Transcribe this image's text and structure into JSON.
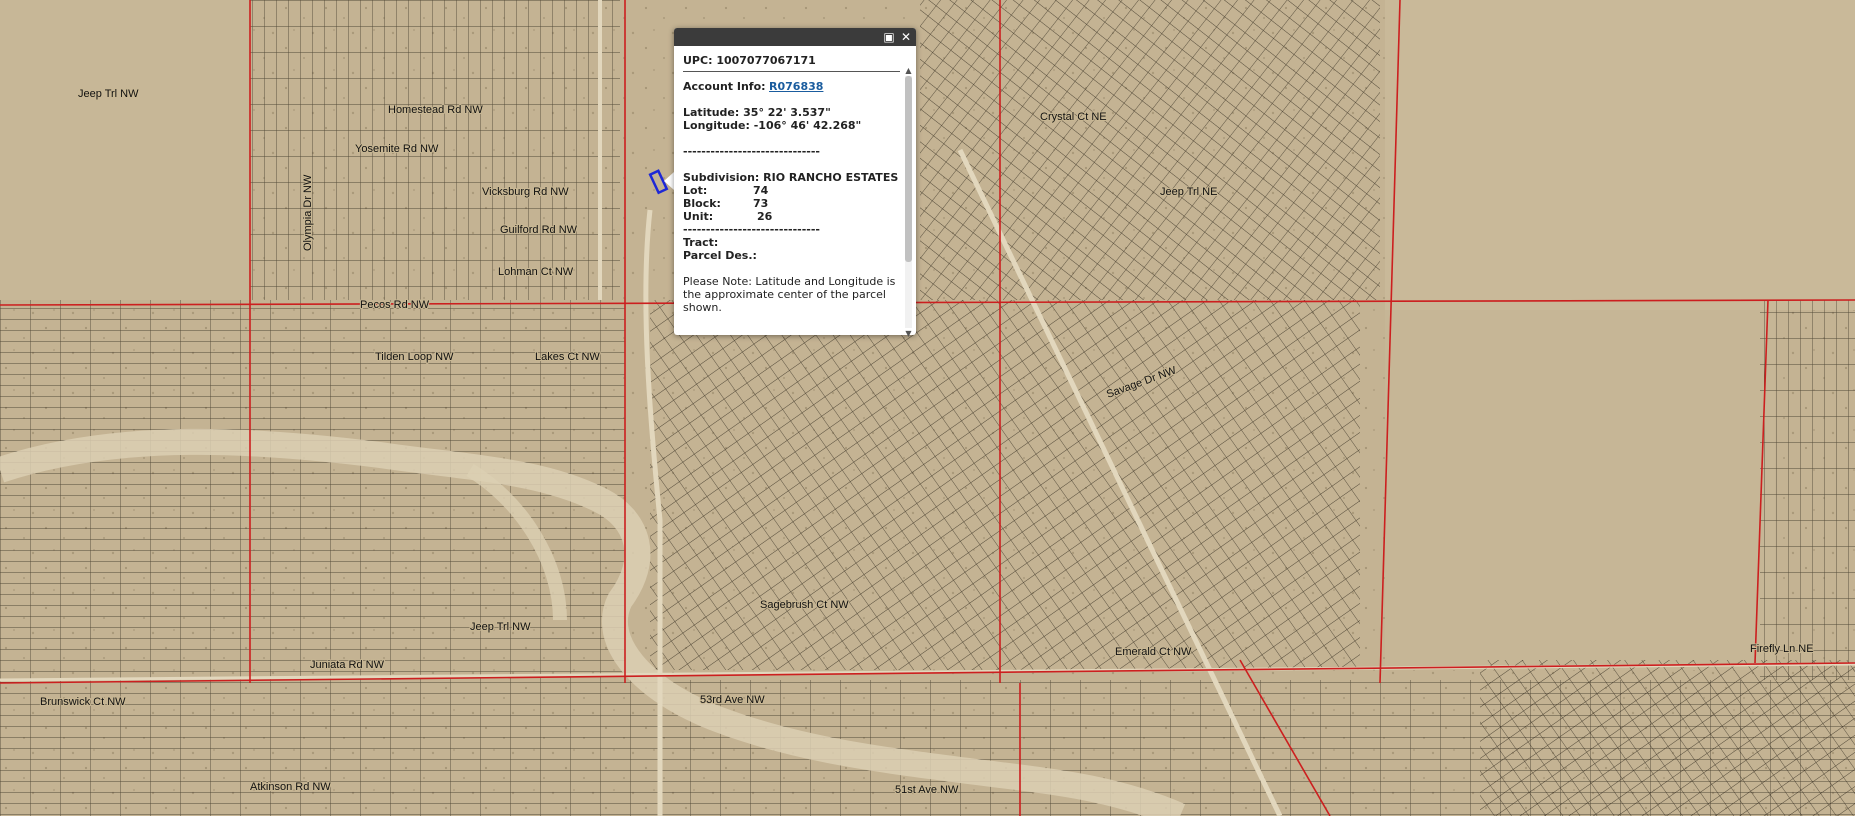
{
  "colors": {
    "land": "#b9a88a",
    "parcel_line": "#2b2418",
    "boundary_line": "#cc1f1f",
    "arroyo": "#d9ccb0",
    "highlight": "#1e28d6"
  },
  "popup": {
    "maximize_icon": "maximize-icon",
    "close_icon": "close-icon",
    "upc_label": "UPC:",
    "upc_value": "1007077067171",
    "account_label": "Account Info:",
    "account_value": "R076838",
    "latitude_label": "Latitude:",
    "latitude_value": "35° 22' 3.537\"",
    "longitude_label": "Longitude:",
    "longitude_value": "-106° 46' 42.268\"",
    "divider": "------------------------------",
    "subdivision_label": "Subdivision:",
    "subdivision_value": "RIO RANCHO ESTATES",
    "lot_label": "Lot:",
    "lot_value": "74",
    "block_label": "Block:",
    "block_value": "73",
    "unit_label": "Unit:",
    "unit_value": "26",
    "tract_label": "Tract:",
    "parcel_des_label": "Parcel Des.:",
    "note": "Please Note: Latitude and Longitude is the approximate center of the parcel shown."
  },
  "streets": [
    {
      "name": "Jeep Trl NW"
    },
    {
      "name": "Homestead Rd NW"
    },
    {
      "name": "Yosemite Rd NW"
    },
    {
      "name": "Vicksburg Rd NW"
    },
    {
      "name": "Guilford Rd NW"
    },
    {
      "name": "Lohman Ct NW"
    },
    {
      "name": "Olympia Dr NW"
    },
    {
      "name": "Pecos Rd NW"
    },
    {
      "name": "Lakes Ct NW"
    },
    {
      "name": "Tilden Loop NW"
    },
    {
      "name": "Crystal Ct NE"
    },
    {
      "name": "Jeep Trl NE"
    },
    {
      "name": "Savage Dr NW"
    },
    {
      "name": "Jeep Trl NW"
    },
    {
      "name": "Juniata Rd NW"
    },
    {
      "name": "Emerald Ct NW"
    },
    {
      "name": "53rd Ave NW"
    },
    {
      "name": "51st Ave NW"
    },
    {
      "name": "Firefly Ln NE"
    },
    {
      "name": "Sagebrush Ct NW"
    },
    {
      "name": "Brunswick Ct NW"
    },
    {
      "name": "Atkinson Rd NW"
    }
  ]
}
